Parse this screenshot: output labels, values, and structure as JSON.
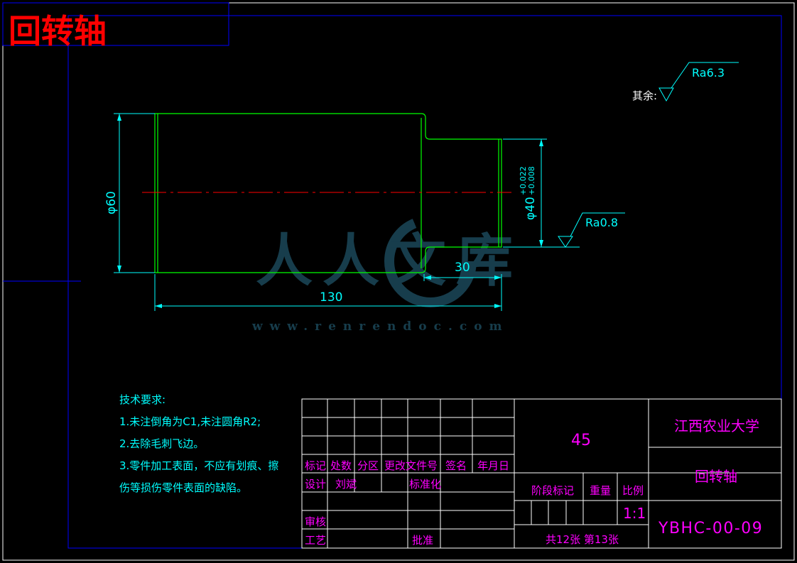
{
  "title": "回转轴",
  "surface_note": {
    "prefix": "其余:",
    "general_roughness": "Ra6.3",
    "shoulder_roughness": "Ra0.8"
  },
  "dimensions": {
    "large_diameter": "φ60",
    "small_diameter": "φ40",
    "tol_upper": "+0.022",
    "tol_lower": "+0.008",
    "step_length": "30",
    "total_length": "130"
  },
  "watermark": {
    "text": "人人文库",
    "url": "www.renrendoc.com"
  },
  "tech_requirements": {
    "heading": "技术要求:",
    "items": [
      "1.未注倒角为C1,未注圆角R2;",
      "2.去除毛刺飞边。",
      "3.零件加工表面，不应有划痕、擦",
      "伤等损伤零件表面的缺陷。"
    ]
  },
  "title_block": {
    "headers": [
      "标记",
      "处数",
      "分区",
      "更改文件号",
      "签名",
      "年月日"
    ],
    "design_label": "设计",
    "designer": "刘斌",
    "standardize_label": "标准化",
    "review_label": "审核",
    "process_label": "工艺",
    "approve_label": "批准",
    "material": "45",
    "stage_label": "阶段标记",
    "weight_label": "重量",
    "scale_label": "比例",
    "scale": "1:1",
    "sheets": "共12张 第13张",
    "school": "江西农业大学",
    "part_name": "回转轴",
    "drawing_no": "YBHC-00-09"
  },
  "colors": {
    "background": "#000000",
    "frame": "#0000ff",
    "outline": "#00ff00",
    "dimension": "#00ffff",
    "centerline": "#ff0000",
    "title_red": "#ff0000",
    "block_text": "#ff00ff",
    "block_lines": "#ffffff",
    "watermark": "#2a6f8a"
  }
}
